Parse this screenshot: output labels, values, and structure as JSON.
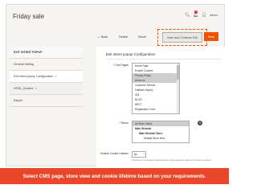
{
  "header": {
    "title": "Friday sale",
    "notification_count": "1",
    "user": "admin"
  },
  "actions": {
    "back": "← Back",
    "delete": "Delete",
    "reset": "Reset",
    "save_continue": "Save and Continue Edit",
    "save": "Save"
  },
  "sidebar": {
    "items": [
      {
        "label": "EXIT INTENT POPUP"
      },
      {
        "label": "General Setting"
      },
      {
        "label": "Exit intent popup Configuration"
      },
      {
        "label": "HTML_Content"
      },
      {
        "label": "Report"
      }
    ]
  },
  "section": {
    "title": "Exit intent popup Configuration"
  },
  "fields": {
    "cms_label": "Cms Pages",
    "cms_options": [
      "Home Page",
      "Enable Cookies",
      "Privacy Policy",
      "About us",
      "Customer Service",
      "Fallback Inquiry",
      "404",
      "BLOG",
      "NECT",
      "Registration Form"
    ],
    "stores_label": "Stores",
    "stores_options": [
      "All Store Views",
      "Main Website",
      "Main Website Store",
      "Default Store View"
    ],
    "cookie_label": "Enable Cookie Lifetime",
    "cookie_value": "No",
    "cookie_note": "If customer is eventually closed/remove it popup appears again for the same customer"
  },
  "banner": {
    "text": "Select CMS page, store view and cookie lifetime based on your requirements."
  },
  "colors": {
    "accent": "#eb5202",
    "banner": "#e9462a"
  }
}
